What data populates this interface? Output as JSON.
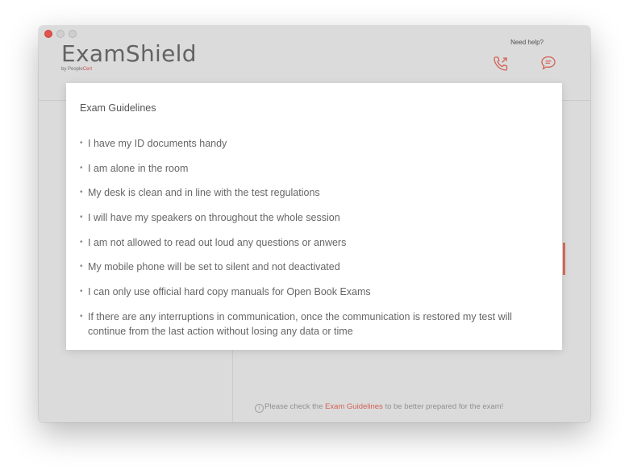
{
  "app": {
    "title": "ExamShield",
    "subtitle_prefix": "by People",
    "subtitle_brand": "Cert"
  },
  "header": {
    "help_label": "Need help?",
    "phone_icon": "phone-icon",
    "chat_icon": "chat-bubble-icon"
  },
  "colors": {
    "accent": "#e0685a",
    "close_light": "#ef5a52"
  },
  "modal": {
    "title": "Exam Guidelines",
    "items": [
      "I have my ID documents handy",
      "I am alone in the room",
      "My desk is clean and in line with the test regulations",
      "I will have my speakers on throughout the whole session",
      "I am not allowed to read out loud any questions or anwers",
      "My mobile phone will be set to silent and not deactivated",
      "I can only use official hard copy manuals for Open Book Exams",
      "If there are any interruptions in communication, once the communication is restored my test will continue from the last action without losing any data or time"
    ]
  },
  "footer": {
    "info_glyph": "i",
    "prefix": "Please check the ",
    "link": "Exam Guidelines",
    "suffix": " to be better prepared for the exam!"
  }
}
